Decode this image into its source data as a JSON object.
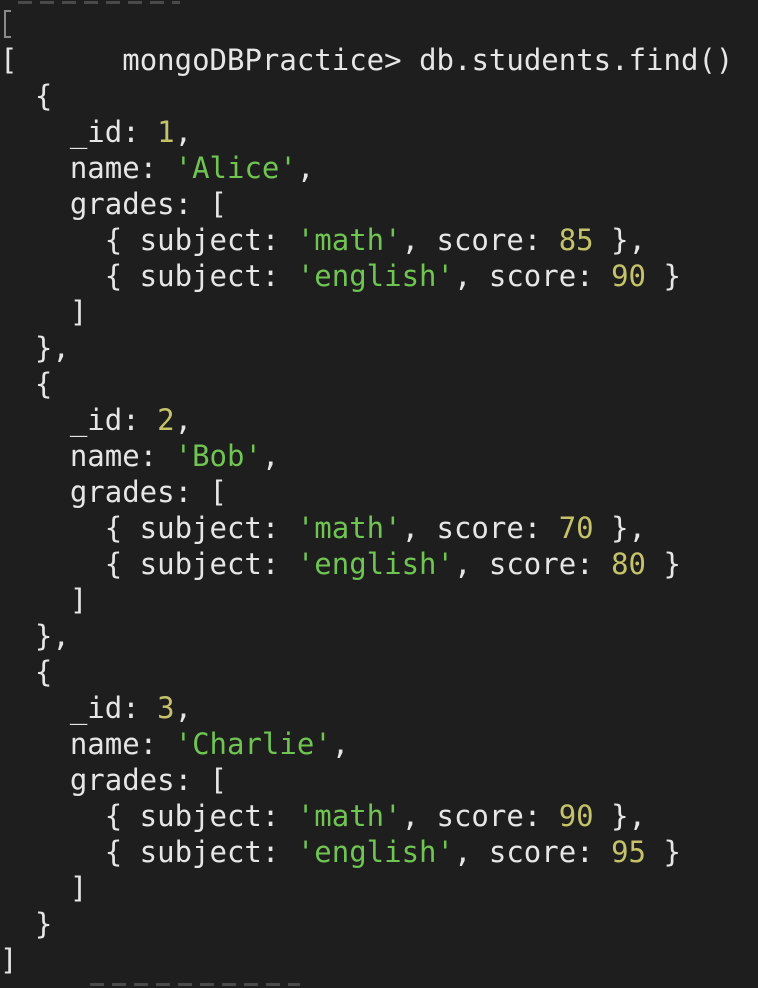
{
  "terminal": {
    "prompt": "mongoDBPractice>",
    "command": "db.students.find()"
  },
  "colors": {
    "background": "#1e1e1e",
    "text": "#e6e6e6",
    "number": "#c5c26a",
    "string": "#6fc452"
  },
  "output": {
    "lines": [
      [
        {
          "t": "[",
          "c": "punc"
        }
      ],
      [
        {
          "t": "  {",
          "c": "punc"
        }
      ],
      [
        {
          "t": "    _id: ",
          "c": "key"
        },
        {
          "t": "1",
          "c": "num"
        },
        {
          "t": ",",
          "c": "punc"
        }
      ],
      [
        {
          "t": "    name: ",
          "c": "key"
        },
        {
          "t": "'Alice'",
          "c": "str"
        },
        {
          "t": ",",
          "c": "punc"
        }
      ],
      [
        {
          "t": "    grades: [",
          "c": "key"
        }
      ],
      [
        {
          "t": "      { subject: ",
          "c": "key"
        },
        {
          "t": "'math'",
          "c": "str"
        },
        {
          "t": ", score: ",
          "c": "key"
        },
        {
          "t": "85",
          "c": "num"
        },
        {
          "t": " },",
          "c": "punc"
        }
      ],
      [
        {
          "t": "      { subject: ",
          "c": "key"
        },
        {
          "t": "'english'",
          "c": "str"
        },
        {
          "t": ", score: ",
          "c": "key"
        },
        {
          "t": "90",
          "c": "num"
        },
        {
          "t": " }",
          "c": "punc"
        }
      ],
      [
        {
          "t": "    ]",
          "c": "punc"
        }
      ],
      [
        {
          "t": "  },",
          "c": "punc"
        }
      ],
      [
        {
          "t": "  {",
          "c": "punc"
        }
      ],
      [
        {
          "t": "    _id: ",
          "c": "key"
        },
        {
          "t": "2",
          "c": "num"
        },
        {
          "t": ",",
          "c": "punc"
        }
      ],
      [
        {
          "t": "    name: ",
          "c": "key"
        },
        {
          "t": "'Bob'",
          "c": "str"
        },
        {
          "t": ",",
          "c": "punc"
        }
      ],
      [
        {
          "t": "    grades: [",
          "c": "key"
        }
      ],
      [
        {
          "t": "      { subject: ",
          "c": "key"
        },
        {
          "t": "'math'",
          "c": "str"
        },
        {
          "t": ", score: ",
          "c": "key"
        },
        {
          "t": "70",
          "c": "num"
        },
        {
          "t": " },",
          "c": "punc"
        }
      ],
      [
        {
          "t": "      { subject: ",
          "c": "key"
        },
        {
          "t": "'english'",
          "c": "str"
        },
        {
          "t": ", score: ",
          "c": "key"
        },
        {
          "t": "80",
          "c": "num"
        },
        {
          "t": " }",
          "c": "punc"
        }
      ],
      [
        {
          "t": "    ]",
          "c": "punc"
        }
      ],
      [
        {
          "t": "  },",
          "c": "punc"
        }
      ],
      [
        {
          "t": "  {",
          "c": "punc"
        }
      ],
      [
        {
          "t": "    _id: ",
          "c": "key"
        },
        {
          "t": "3",
          "c": "num"
        },
        {
          "t": ",",
          "c": "punc"
        }
      ],
      [
        {
          "t": "    name: ",
          "c": "key"
        },
        {
          "t": "'Charlie'",
          "c": "str"
        },
        {
          "t": ",",
          "c": "punc"
        }
      ],
      [
        {
          "t": "    grades: [",
          "c": "key"
        }
      ],
      [
        {
          "t": "      { subject: ",
          "c": "key"
        },
        {
          "t": "'math'",
          "c": "str"
        },
        {
          "t": ", score: ",
          "c": "key"
        },
        {
          "t": "90",
          "c": "num"
        },
        {
          "t": " },",
          "c": "punc"
        }
      ],
      [
        {
          "t": "      { subject: ",
          "c": "key"
        },
        {
          "t": "'english'",
          "c": "str"
        },
        {
          "t": ", score: ",
          "c": "key"
        },
        {
          "t": "95",
          "c": "num"
        },
        {
          "t": " }",
          "c": "punc"
        }
      ],
      [
        {
          "t": "    ]",
          "c": "punc"
        }
      ],
      [
        {
          "t": "  }",
          "c": "punc"
        }
      ],
      [
        {
          "t": "]",
          "c": "punc"
        }
      ]
    ]
  }
}
